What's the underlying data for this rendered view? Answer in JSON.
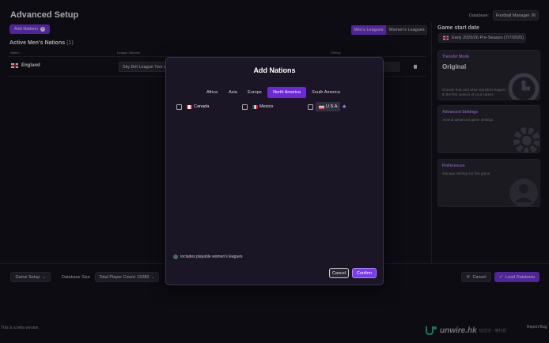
{
  "header": {
    "title": "Advanced Setup",
    "database_label": "Database:",
    "database_value": "Football Manager 26"
  },
  "toolbar": {
    "add_nations_label": "Add Nations",
    "men_leagues": "Men's Leagues",
    "women_leagues": "Women's Leagues"
  },
  "active": {
    "title": "Active Men's Nations",
    "count": "(1)",
    "col_nation": "Nation",
    "col_league": "League Selector",
    "col_setting": "Setting",
    "rows": [
      {
        "nation": "England",
        "league": "Sky Bet League Two a"
      }
    ]
  },
  "right": {
    "start_date_title": "Game start date",
    "start_date_value": "Early 2025/26 Pre-Season (7/7/2025)",
    "cards": [
      {
        "head": "Transfer Mode",
        "main": "Original",
        "desc": "Choose how and when transfers happen in the first season of your career."
      },
      {
        "head": "Advanced Settings",
        "desc": "Amend advanced game settings."
      },
      {
        "head": "Preferences",
        "desc": "Manage settings for this game."
      }
    ]
  },
  "modal": {
    "title": "Add Nations",
    "tabs": [
      "Africa",
      "Asia",
      "Europe",
      "North America",
      "South America"
    ],
    "active_tab": "North America",
    "nations": [
      {
        "name": "Canada",
        "checked": false
      },
      {
        "name": "Mexico",
        "checked": false
      },
      {
        "name": "U.S.A.",
        "checked": false,
        "starred": true
      }
    ],
    "toggle_label": "Includes playable women's leagues",
    "cancel": "Cancel",
    "confirm": "Confirm"
  },
  "footer": {
    "game_setup": "Game Setup",
    "database_size_label": "Database Size",
    "player_count": "Total Player Count: 15280",
    "cancel": "Cancel",
    "load_database": "Load Database",
    "beta_note": "This is a beta version",
    "report_bug": "Report Bug",
    "watermark": "unwire.hk",
    "watermark_sub": "玩生活 · 樂科技"
  },
  "colors": {
    "accent": "#7c3aed",
    "card_head": "#c084fc",
    "background": "#15131d"
  }
}
